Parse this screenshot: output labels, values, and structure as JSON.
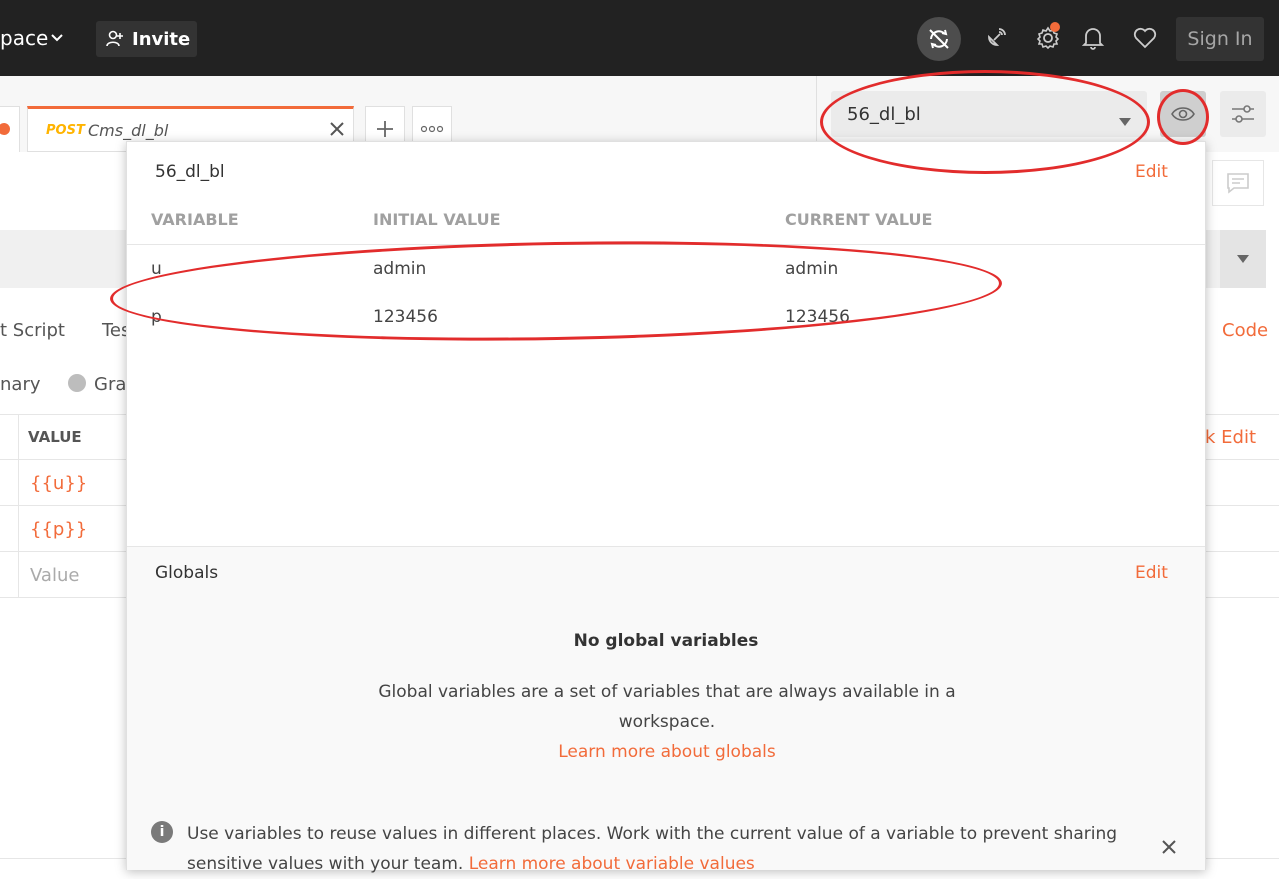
{
  "header": {
    "workspace_label": "pace",
    "invite_label": "Invite",
    "signin_label": "Sign In"
  },
  "tabs": {
    "active": {
      "method": "POST",
      "title": "Cms_dl_bl"
    }
  },
  "environment": {
    "selected": "56_dl_bl"
  },
  "background": {
    "req_tabs": [
      "t Script",
      "Tes"
    ],
    "code_label": "Code",
    "body_options": [
      "nary",
      "Gra"
    ],
    "table_value_header": "VALUE",
    "bulk_edit_label": "lk Edit",
    "rows": [
      {
        "value": "{{u}}"
      },
      {
        "value": "{{p}}"
      },
      {
        "value": "Value"
      }
    ]
  },
  "popover": {
    "env_name": "56_dl_bl",
    "edit_label": "Edit",
    "columns": [
      "VARIABLE",
      "INITIAL VALUE",
      "CURRENT VALUE"
    ],
    "variables": [
      {
        "name": "u",
        "initial": "admin",
        "current": "admin"
      },
      {
        "name": "p",
        "initial": "123456",
        "current": "123456"
      }
    ],
    "globals": {
      "title": "Globals",
      "edit_label": "Edit",
      "empty_title": "No global variables",
      "description": "Global variables are a set of variables that are always available in a workspace.",
      "learn_more": "Learn more about globals"
    },
    "info": {
      "text": "Use variables to reuse values in different places. Work with the current value of a variable to prevent sharing sensitive values with your team.",
      "link": "Learn more about variable values"
    }
  },
  "colors": {
    "accent": "#f26b3a",
    "method_post": "#ffb400",
    "topbar": "#222222",
    "annotation": "#e22c2c"
  }
}
